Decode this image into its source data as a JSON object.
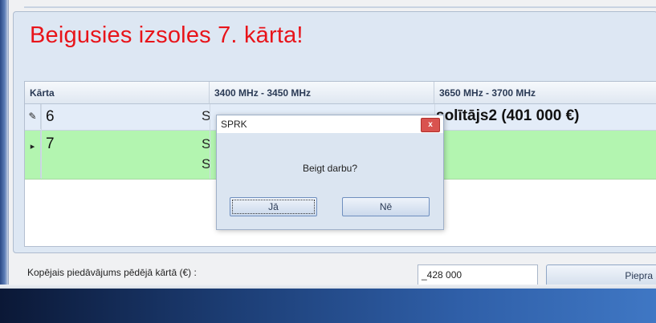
{
  "heading": "Beigusies izsoles 7. kārta!",
  "grid": {
    "columns": [
      "Kārta",
      "3400 MHz - 3450 MHz",
      "3650 MHz - 3700 MHz"
    ],
    "rows": [
      {
        "indicator": "✎",
        "round": "6",
        "col1_visible": "S",
        "col2": "solītājs2 (401 000 €)"
      },
      {
        "indicator": "▸",
        "round": "7",
        "col1_line1": "S",
        "col1_line2": "S"
      }
    ]
  },
  "footer": {
    "total_label": "Kopējais piedāvājums pēdējā kārtā (€) :",
    "total_value": "_428 000",
    "submit_label": "Piepra"
  },
  "dialog": {
    "title": "SPRK",
    "close_label": "x",
    "message": "Beigt darbu?",
    "yes_label": "Jā",
    "no_label": "Nē"
  }
}
